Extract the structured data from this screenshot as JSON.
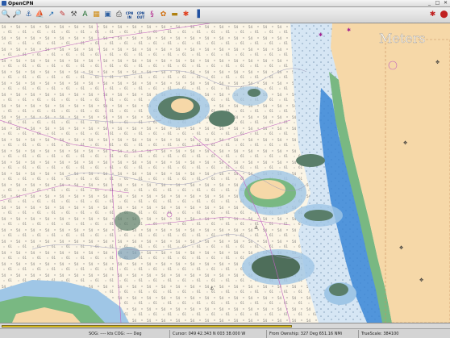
{
  "window": {
    "title": "OpenCPN",
    "minimize_label": "_",
    "maximize_label": "□",
    "close_label": "✕"
  },
  "toolbar": {
    "buttons": [
      {
        "name": "zoom-in",
        "glyph": "🔍"
      },
      {
        "name": "zoom-out",
        "glyph": "🔎"
      },
      {
        "name": "scale-in",
        "glyph": "⚓"
      },
      {
        "name": "scale-out",
        "glyph": "⛵"
      },
      {
        "name": "route",
        "glyph": "↗"
      },
      {
        "name": "follow",
        "glyph": "✎"
      },
      {
        "name": "settings",
        "glyph": "⚒"
      },
      {
        "name": "text",
        "glyph": "A"
      },
      {
        "name": "tide",
        "glyph": "▦"
      },
      {
        "name": "current",
        "glyph": "▣"
      },
      {
        "name": "print",
        "glyph": "⎙"
      },
      {
        "name": "cpn-in",
        "label": "CPN IN"
      },
      {
        "name": "cpn-out",
        "label": "CPN OUT"
      },
      {
        "name": "route-manager",
        "glyph": "§"
      },
      {
        "name": "track",
        "glyph": "✿"
      },
      {
        "name": "colorscheme",
        "glyph": "▬"
      },
      {
        "name": "mob",
        "glyph": "✱"
      },
      {
        "name": "help",
        "glyph": "▐"
      }
    ],
    "right_buttons": [
      {
        "name": "settings-right",
        "glyph": "✱"
      },
      {
        "name": "alert-right",
        "glyph": "⬤"
      }
    ]
  },
  "chart": {
    "watermark": "Meters",
    "colors": {
      "land": "#f6d8a8",
      "shallow": "#9fc6e6",
      "deep": "#f9f8f0",
      "coast_green": "#79b882",
      "blue_zone": "#3a86d6",
      "magenta": "#c060c0"
    }
  },
  "scale_bar": {
    "fill_color": "#f0d020"
  },
  "status": {
    "sog": "SOG: ---- kts  COG: ---- Deg",
    "cursor": "Cursor: 049 42.343 N  003 38.000 W",
    "from": "From Ownship: 327 Deg  651.16 NMi",
    "scale": "TrueScale:  384100"
  }
}
